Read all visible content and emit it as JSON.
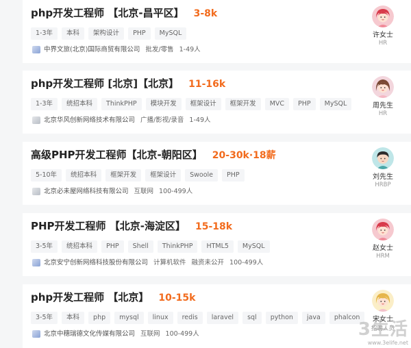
{
  "jobs": [
    {
      "title": "php开发工程师 【北京-昌平区】",
      "salary": "3-8k",
      "tags": [
        "1-3年",
        "本科",
        "架构设计",
        "PHP",
        "MySQL"
      ],
      "company": "中界文旅(北京)国际商贸有限公司",
      "meta": [
        "批发/零售",
        "1-49人"
      ],
      "hr_name": "许女士",
      "hr_role": "HR",
      "avatar": "female-avatar-icon"
    },
    {
      "title": "php开发工程师 [北京]【北京】",
      "salary": "11-16k",
      "tags": [
        "1-3年",
        "统招本科",
        "ThinkPHP",
        "模块开发",
        "框架设计",
        "框架开发",
        "MVC",
        "PHP",
        "MySQL"
      ],
      "company": "北京华风创新网络技术有限公司",
      "meta": [
        "广播/影视/录音",
        "1-49人"
      ],
      "hr_name": "周先生",
      "hr_role": "HR",
      "avatar": "female-avatar-icon"
    },
    {
      "title": "高级PHP开发工程师【北京-朝阳区】",
      "salary": "20-30k·18薪",
      "tags": [
        "5-10年",
        "统招本科",
        "框架开发",
        "框架设计",
        "Swoole",
        "PHP"
      ],
      "company": "北京必未屋网络科技有限公司",
      "meta": [
        "互联网",
        "100-499人"
      ],
      "hr_name": "刘先生",
      "hr_role": "HRBP",
      "avatar": "male-avatar-icon"
    },
    {
      "title": "PHP开发工程师 【北京-海淀区】",
      "salary": "15-18k",
      "tags": [
        "3-5年",
        "统招本科",
        "PHP",
        "Shell",
        "ThinkPHP",
        "HTML5",
        "MySQL"
      ],
      "company": "北京安宁创新网络科技股份有限公司",
      "meta": [
        "计算机软件",
        "融资未公开",
        "100-499人"
      ],
      "hr_name": "赵女士",
      "hr_role": "HRM",
      "avatar": "female-avatar-icon"
    },
    {
      "title": "php开发工程师 【北京】",
      "salary": "10-15k",
      "tags": [
        "3-5年",
        "本科",
        "php",
        "mysql",
        "linux",
        "redis",
        "laravel",
        "sql",
        "python",
        "java",
        "phalcon"
      ],
      "company": "北京中穗瑞德文化传媒有限公司",
      "meta": [
        "互联网",
        "100-499人"
      ],
      "hr_name": "宋女士",
      "hr_role": "招聘人员",
      "avatar": "female-avatar-icon"
    }
  ],
  "watermark": {
    "big": "3生活",
    "small": "www.3elife.net"
  },
  "colors": {
    "salary": "#f26b1d",
    "background": "#f5f6f7",
    "card": "#ffffff"
  }
}
